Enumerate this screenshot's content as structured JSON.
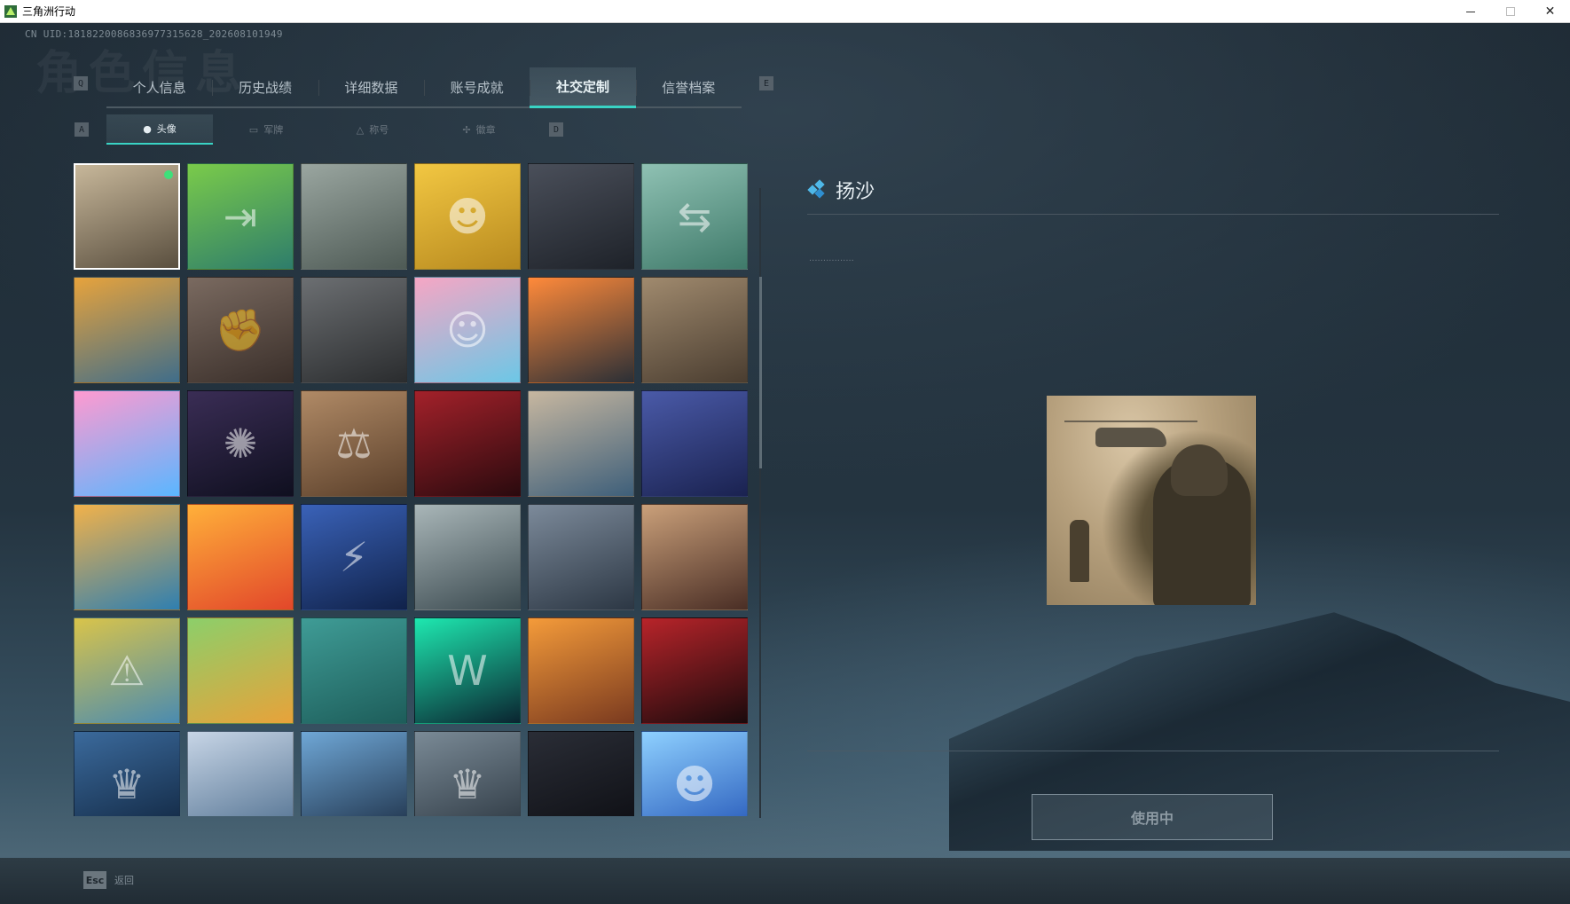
{
  "window": {
    "title": "三角洲行动"
  },
  "header": {
    "uid": "CN UID:1818220086836977315628_202608101949",
    "page_title": "角色信息"
  },
  "main_tabs": {
    "prev_key": "Q",
    "next_key": "E",
    "items": [
      {
        "label": "个人信息"
      },
      {
        "label": "历史战绩"
      },
      {
        "label": "详细数据"
      },
      {
        "label": "账号成就"
      },
      {
        "label": "社交定制",
        "active": true
      },
      {
        "label": "信誉档案"
      }
    ]
  },
  "sub_tabs": {
    "prev_key": "A",
    "next_key": "D",
    "items": [
      {
        "label": "头像",
        "icon": "person-icon",
        "active": true
      },
      {
        "label": "军牌",
        "icon": "badge-icon"
      },
      {
        "label": "称号",
        "icon": "title-icon"
      },
      {
        "label": "徽章",
        "icon": "emblem-icon"
      }
    ]
  },
  "avatars": [
    {
      "colors": [
        "#c7b79a",
        "#5a4f3f"
      ],
      "glyph": "",
      "selected": true
    },
    {
      "colors": [
        "#7acb4a",
        "#2e7d6b"
      ],
      "glyph": "⇥"
    },
    {
      "colors": [
        "#9aa6a0",
        "#4e5a55"
      ],
      "glyph": ""
    },
    {
      "colors": [
        "#f2c742",
        "#b88a1f"
      ],
      "glyph": "☻"
    },
    {
      "colors": [
        "#4a4f5a",
        "#1e2229"
      ],
      "glyph": ""
    },
    {
      "colors": [
        "#8fc1b3",
        "#3f7a6a"
      ],
      "glyph": "⇆"
    },
    {
      "colors": [
        "#e7a33c",
        "#3f6d8a"
      ],
      "glyph": ""
    },
    {
      "colors": [
        "#7a6a60",
        "#3a2f2a"
      ],
      "glyph": "✊"
    },
    {
      "colors": [
        "#6c6f72",
        "#2a2c2e"
      ],
      "glyph": ""
    },
    {
      "colors": [
        "#f6a6c4",
        "#6cc7e6"
      ],
      "glyph": "☺"
    },
    {
      "colors": [
        "#ff8a3a",
        "#2b2f36"
      ],
      "glyph": ""
    },
    {
      "colors": [
        "#a08a6e",
        "#4a3d30"
      ],
      "glyph": ""
    },
    {
      "colors": [
        "#ff9ad0",
        "#5ab6ff"
      ],
      "glyph": ""
    },
    {
      "colors": [
        "#3a2d55",
        "#0f0f1f"
      ],
      "glyph": "✺"
    },
    {
      "colors": [
        "#b08a66",
        "#5a3f2a"
      ],
      "glyph": "⚖"
    },
    {
      "colors": [
        "#a3212a",
        "#2a0a0e"
      ],
      "glyph": ""
    },
    {
      "colors": [
        "#c7b7a0",
        "#3e5f7a"
      ],
      "glyph": ""
    },
    {
      "colors": [
        "#4a5aa8",
        "#1a2250"
      ],
      "glyph": ""
    },
    {
      "colors": [
        "#f2b24a",
        "#2f7fb0"
      ],
      "glyph": ""
    },
    {
      "colors": [
        "#ffb03a",
        "#e2472a"
      ],
      "glyph": ""
    },
    {
      "colors": [
        "#3a62b8",
        "#10224a"
      ],
      "glyph": "⚡"
    },
    {
      "colors": [
        "#a9b6b8",
        "#3b4a50"
      ],
      "glyph": ""
    },
    {
      "colors": [
        "#7c8a9a",
        "#2c3744"
      ],
      "glyph": ""
    },
    {
      "colors": [
        "#caa07a",
        "#4a2e25"
      ],
      "glyph": ""
    },
    {
      "colors": [
        "#d9c44a",
        "#4a8bb0"
      ],
      "glyph": "⚠"
    },
    {
      "colors": [
        "#8ccf6a",
        "#e8a23a"
      ],
      "glyph": ""
    },
    {
      "colors": [
        "#3f9c96",
        "#1d5d5a"
      ],
      "glyph": ""
    },
    {
      "colors": [
        "#1ee8b0",
        "#0a2430"
      ],
      "glyph": "W"
    },
    {
      "colors": [
        "#f49b3a",
        "#7a3a1f"
      ],
      "glyph": ""
    },
    {
      "colors": [
        "#b8242a",
        "#1a0a0c"
      ],
      "glyph": ""
    },
    {
      "colors": [
        "#3b6a9c",
        "#10253f"
      ],
      "glyph": "♛"
    },
    {
      "colors": [
        "#c7d5e6",
        "#4f6f8f"
      ],
      "glyph": ""
    },
    {
      "colors": [
        "#6fa7d6",
        "#1c2e45"
      ],
      "glyph": ""
    },
    {
      "colors": [
        "#7a8a96",
        "#2b3640"
      ],
      "glyph": "♛"
    },
    {
      "colors": [
        "#2a2d36",
        "#0c0d12"
      ],
      "glyph": ""
    },
    {
      "colors": [
        "#8ed0ff",
        "#2557b8"
      ],
      "glyph": "☻"
    }
  ],
  "detail": {
    "name": "扬沙",
    "description": "················",
    "button_label": "使用中"
  },
  "footer": {
    "esc_key": "Esc",
    "back_label": "返回"
  }
}
